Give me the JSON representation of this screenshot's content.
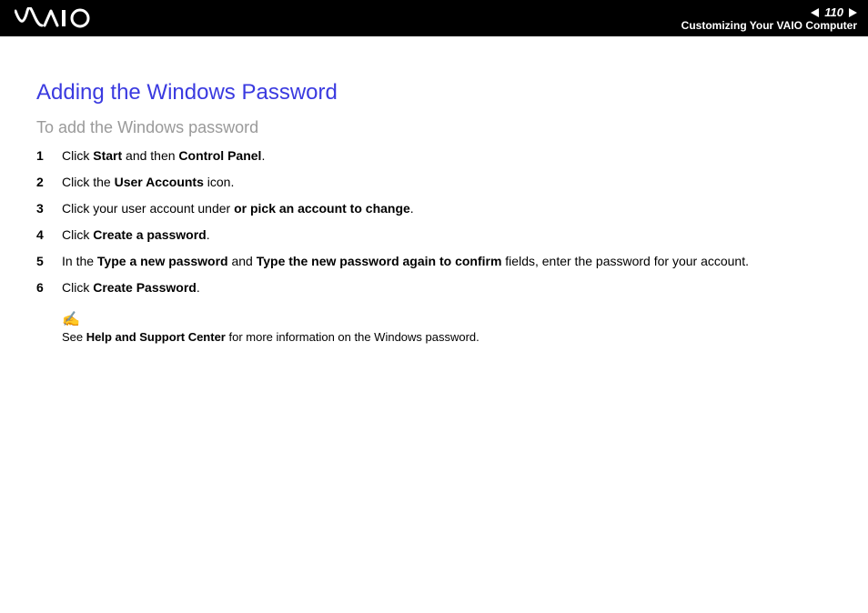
{
  "header": {
    "page_number": "110",
    "section": "Customizing Your VAIO Computer"
  },
  "title": "Adding the Windows Password",
  "subtitle": "To add the Windows password",
  "steps": [
    {
      "n": "1",
      "html": "Click <b>Start</b> and then <b>Control Panel</b>."
    },
    {
      "n": "2",
      "html": "Click the <b>User Accounts</b> icon."
    },
    {
      "n": "3",
      "html": "Click your user account under <b>or pick an account to change</b>."
    },
    {
      "n": "4",
      "html": "Click <b>Create a password</b>."
    },
    {
      "n": "5",
      "html": "In the <b>Type a new password</b> and <b>Type the new password again to confirm</b> fields, enter the password for your account."
    },
    {
      "n": "6",
      "html": "Click <b>Create Password</b>."
    }
  ],
  "note": {
    "html": "See <b>Help and Support Center</b> for more information on the Windows password."
  }
}
